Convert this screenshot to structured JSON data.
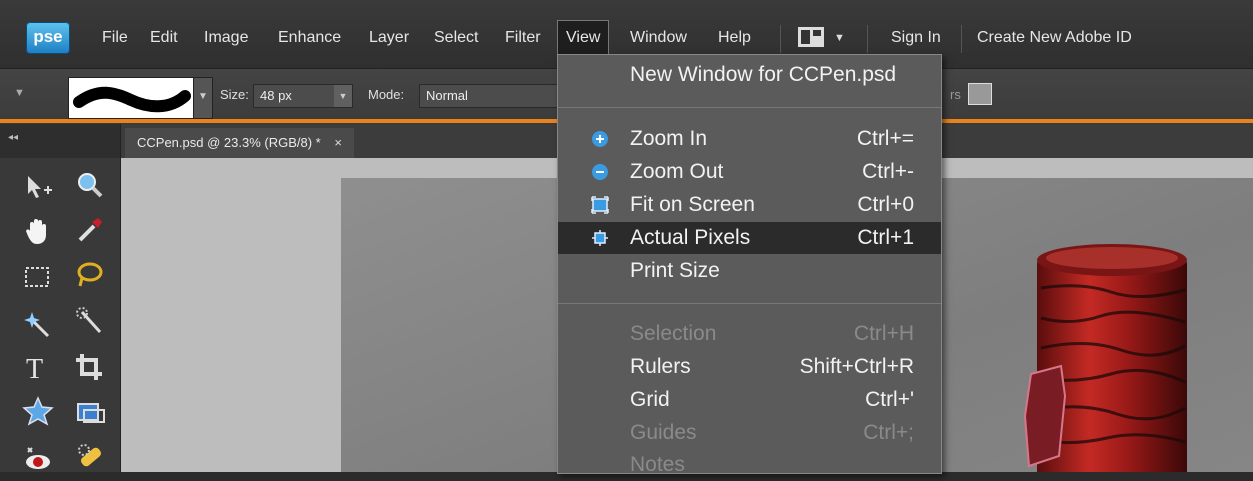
{
  "app": {
    "logo": "pse"
  },
  "menubar": {
    "items": [
      "File",
      "Edit",
      "Image",
      "Enhance",
      "Layer",
      "Select",
      "Filter",
      "View",
      "Window",
      "Help"
    ],
    "workspace_icon": "workspace-layout-icon",
    "sign_in": "Sign In",
    "create_id": "Create New Adobe ID"
  },
  "options": {
    "size_label": "Size:",
    "size_value": "48 px",
    "mode_label": "Mode:",
    "mode_value": "Normal",
    "partial_label": "rs"
  },
  "document": {
    "tab_title": "CCPen.psd @ 23.3% (RGB/8) *",
    "close_glyph": "×"
  },
  "view_menu": {
    "new_window": "New Window for CCPen.psd",
    "zoom_in": {
      "label": "Zoom In",
      "shortcut": "Ctrl+="
    },
    "zoom_out": {
      "label": "Zoom Out",
      "shortcut": "Ctrl+-"
    },
    "fit_on_screen": {
      "label": "Fit on Screen",
      "shortcut": "Ctrl+0"
    },
    "actual_pixels": {
      "label": "Actual Pixels",
      "shortcut": "Ctrl+1"
    },
    "print_size": {
      "label": "Print Size"
    },
    "selection": {
      "label": "Selection",
      "shortcut": "Ctrl+H"
    },
    "rulers": {
      "label": "Rulers",
      "shortcut": "Shift+Ctrl+R"
    },
    "grid": {
      "label": "Grid",
      "shortcut": "Ctrl+'"
    },
    "guides": {
      "label": "Guides",
      "shortcut": "Ctrl+;"
    },
    "notes": {
      "label": "Notes"
    }
  },
  "colors": {
    "accent_orange": "#e9841c",
    "menu_bg": "#5b5b5b",
    "highlight_bg": "#2b2b2b",
    "zoom_icon_blue": "#3a9be0",
    "pen_red": "#b0231f"
  }
}
